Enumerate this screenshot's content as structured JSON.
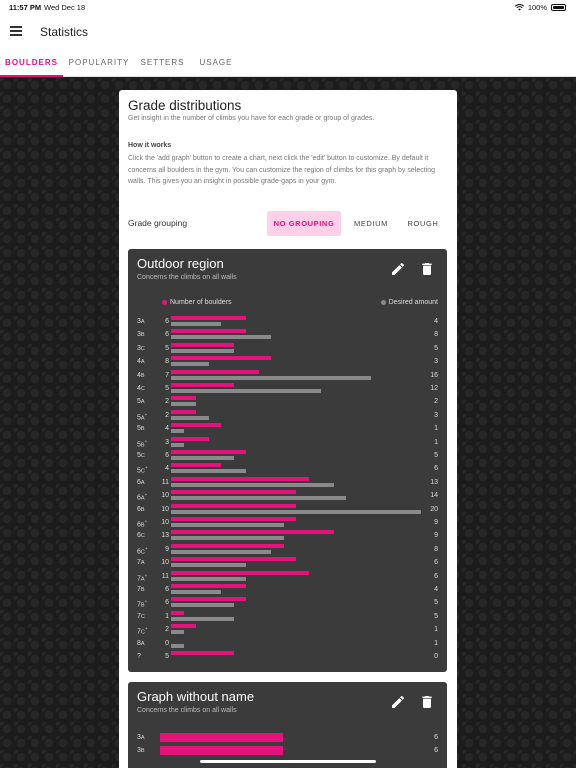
{
  "status_bar": {
    "time": "11:57 PM",
    "date": "Wed Dec 18",
    "battery": "100%"
  },
  "appbar": {
    "title": "Statistics"
  },
  "tabs": [
    {
      "label": "BOULDERS",
      "active": true
    },
    {
      "label": "POPULARITY",
      "active": false
    },
    {
      "label": "SETTERS",
      "active": false
    },
    {
      "label": "USAGE",
      "active": false
    }
  ],
  "card": {
    "title": "Grade distributions",
    "subtitle": "Get insight in the number of climbs you have for each grade or group of grades.",
    "how_title": "How it works",
    "how_text": "Click the 'add graph' button to create a chart, next click the 'edit' button to customize. By default it concerns all boulders in the gym. You can customize the region of climbs for this graph by selecting walls. This gives you an insight in possible grade-gaps in your gym.",
    "grouping_label": "Grade grouping",
    "grouping_options": [
      {
        "label": "NO GROUPING",
        "active": true
      },
      {
        "label": "MEDIUM",
        "active": false
      },
      {
        "label": "ROUGH",
        "active": false
      }
    ]
  },
  "colors": {
    "accent": "#e4127a",
    "desired": "#8a8a8a",
    "graph_bg": "#3b3b3b"
  },
  "graphs": [
    {
      "title": "Outdoor region",
      "subtitle": "Concerns the climbs on all walls",
      "legend_count": "Number of boulders",
      "legend_desired": "Desired amount",
      "edit_icon": "pencil-icon",
      "delete_icon": "trash-icon"
    },
    {
      "title": "Graph without name",
      "subtitle": "Concerns the climbs on all walls",
      "edit_icon": "pencil-icon",
      "delete_icon": "trash-icon"
    }
  ],
  "chart_data": [
    {
      "type": "bar",
      "title": "Outdoor region",
      "categories": [
        "3A",
        "3B",
        "3C",
        "4A",
        "4B",
        "4C",
        "5A",
        "5A+",
        "5B",
        "5B+",
        "5C",
        "5C+",
        "6A",
        "6A+",
        "6B",
        "6B+",
        "6C",
        "6C+",
        "7A",
        "7A+",
        "7B",
        "7B+",
        "7C",
        "7C+",
        "8A",
        "?"
      ],
      "series": [
        {
          "name": "Number of boulders",
          "values": [
            6,
            6,
            5,
            8,
            7,
            5,
            2,
            2,
            4,
            3,
            6,
            4,
            11,
            10,
            10,
            10,
            13,
            9,
            10,
            11,
            6,
            6,
            1,
            2,
            0,
            5
          ]
        },
        {
          "name": "Desired amount",
          "values": [
            4,
            8,
            5,
            3,
            16,
            12,
            2,
            3,
            1,
            1,
            5,
            6,
            13,
            14,
            20,
            9,
            9,
            8,
            6,
            6,
            4,
            5,
            5,
            1,
            1,
            0
          ]
        }
      ]
    },
    {
      "type": "bar",
      "title": "Graph without name",
      "categories": [
        "3A",
        "3B"
      ],
      "series": [
        {
          "values": [
            6,
            6
          ]
        }
      ]
    }
  ]
}
